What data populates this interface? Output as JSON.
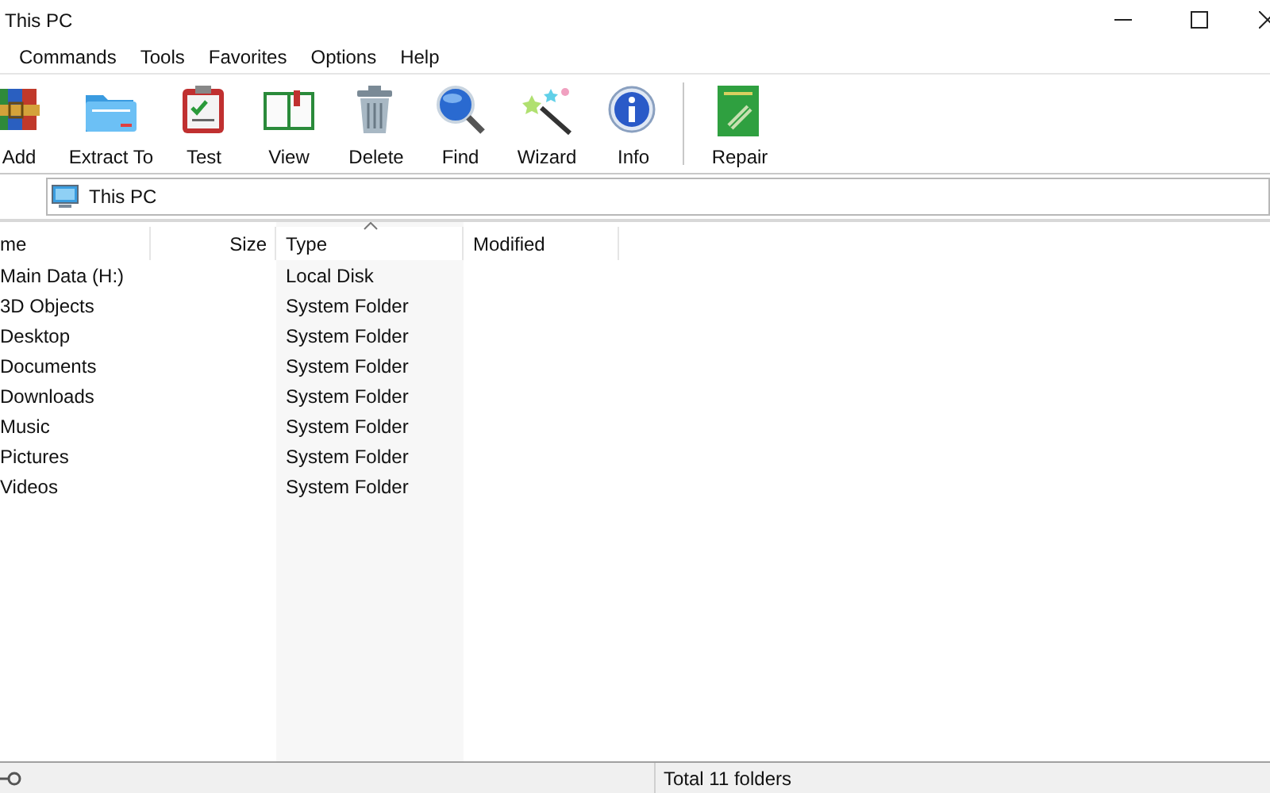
{
  "window": {
    "title": "This PC"
  },
  "menu": [
    "Commands",
    "Tools",
    "Favorites",
    "Options",
    "Help"
  ],
  "toolbar": [
    {
      "label": "Add",
      "kind": "add"
    },
    {
      "label": "Extract To",
      "kind": "extract"
    },
    {
      "label": "Test",
      "kind": "test"
    },
    {
      "label": "View",
      "kind": "view"
    },
    {
      "label": "Delete",
      "kind": "delete"
    },
    {
      "label": "Find",
      "kind": "find"
    },
    {
      "label": "Wizard",
      "kind": "wizard"
    },
    {
      "label": "Info",
      "kind": "info"
    },
    {
      "kind": "separator"
    },
    {
      "label": "Repair",
      "kind": "repair"
    }
  ],
  "address": {
    "value": "This PC"
  },
  "table": {
    "columns": [
      {
        "label": "me",
        "sorted": false
      },
      {
        "label": "Size",
        "sorted": false
      },
      {
        "label": "Type",
        "sorted": true
      },
      {
        "label": "Modified",
        "sorted": false
      }
    ],
    "rows": [
      [
        "Main Data (H:)",
        "",
        "Local Disk",
        ""
      ],
      [
        "3D Objects",
        "",
        "System Folder",
        ""
      ],
      [
        "Desktop",
        "",
        "System Folder",
        ""
      ],
      [
        "Documents",
        "",
        "System Folder",
        ""
      ],
      [
        "Downloads",
        "",
        "System Folder",
        ""
      ],
      [
        "Music",
        "",
        "System Folder",
        ""
      ],
      [
        "Pictures",
        "",
        "System Folder",
        ""
      ],
      [
        "Videos",
        "",
        "System Folder",
        ""
      ]
    ]
  },
  "status_bar": {
    "text": "Total 11 folders"
  }
}
